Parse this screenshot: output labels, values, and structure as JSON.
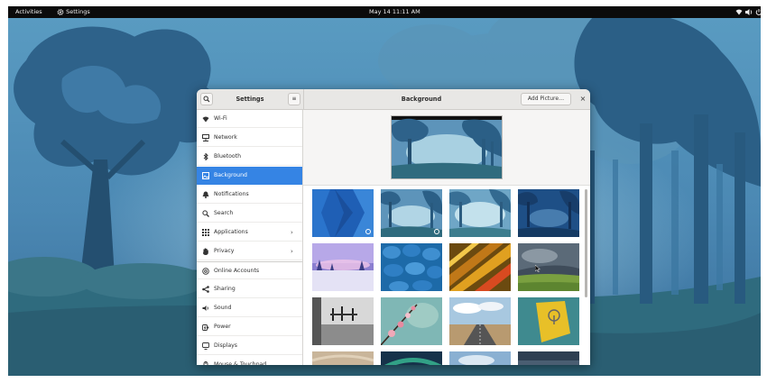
{
  "topbar": {
    "activities": "Activities",
    "app_menu": "Settings",
    "clock": "May 14  11:11 AM",
    "tray_icons": [
      "wifi-icon",
      "volume-icon",
      "power-icon"
    ]
  },
  "window": {
    "sidebar_title": "Settings",
    "page_title": "Background",
    "add_picture_label": "Add Picture…",
    "close_glyph": "×",
    "search_glyph": "⚲",
    "menu_glyph": "≡"
  },
  "sidebar": {
    "items": [
      {
        "label": "Wi-Fi",
        "icon": "wifi-icon"
      },
      {
        "label": "Network",
        "icon": "network-icon"
      },
      {
        "label": "Bluetooth",
        "icon": "bluetooth-icon"
      },
      {
        "label": "Background",
        "icon": "background-icon",
        "selected": true
      },
      {
        "label": "Notifications",
        "icon": "bell-icon"
      },
      {
        "label": "Search",
        "icon": "search-icon"
      },
      {
        "label": "Applications",
        "icon": "apps-grid-icon",
        "chevron": "›"
      },
      {
        "label": "Privacy",
        "icon": "hand-icon",
        "chevron": "›"
      },
      {
        "label": "Online Accounts",
        "icon": "online-accounts-icon"
      },
      {
        "label": "Sharing",
        "icon": "share-icon"
      },
      {
        "label": "Sound",
        "icon": "speaker-icon"
      },
      {
        "label": "Power",
        "icon": "power-icon"
      },
      {
        "label": "Displays",
        "icon": "display-icon"
      },
      {
        "label": "Mouse & Touchpad",
        "icon": "mouse-icon"
      }
    ]
  },
  "colors": {
    "selection": "#3584e4",
    "topbar": "#0b0b0b",
    "wallpaper_blue": "#3f7fa6"
  },
  "wallpapers": [
    {
      "name": "geometric-blue",
      "selected": true
    },
    {
      "name": "forest-day",
      "selected": true
    },
    {
      "name": "forest-day-2",
      "selected": false
    },
    {
      "name": "forest-night",
      "selected": false
    },
    {
      "name": "purple-snow",
      "selected": false
    },
    {
      "name": "blue-tiles",
      "selected": false
    },
    {
      "name": "golden-weave",
      "selected": false
    },
    {
      "name": "storm-field",
      "selected": false
    },
    {
      "name": "monochrome-room",
      "selected": false
    },
    {
      "name": "cherry-blossom",
      "selected": false
    },
    {
      "name": "desert-road",
      "selected": false
    },
    {
      "name": "yellow-lock",
      "selected": false
    },
    {
      "name": "sand",
      "selected": false
    },
    {
      "name": "aurora",
      "selected": false
    },
    {
      "name": "sky",
      "selected": false
    },
    {
      "name": "dark-sea",
      "selected": false
    }
  ]
}
